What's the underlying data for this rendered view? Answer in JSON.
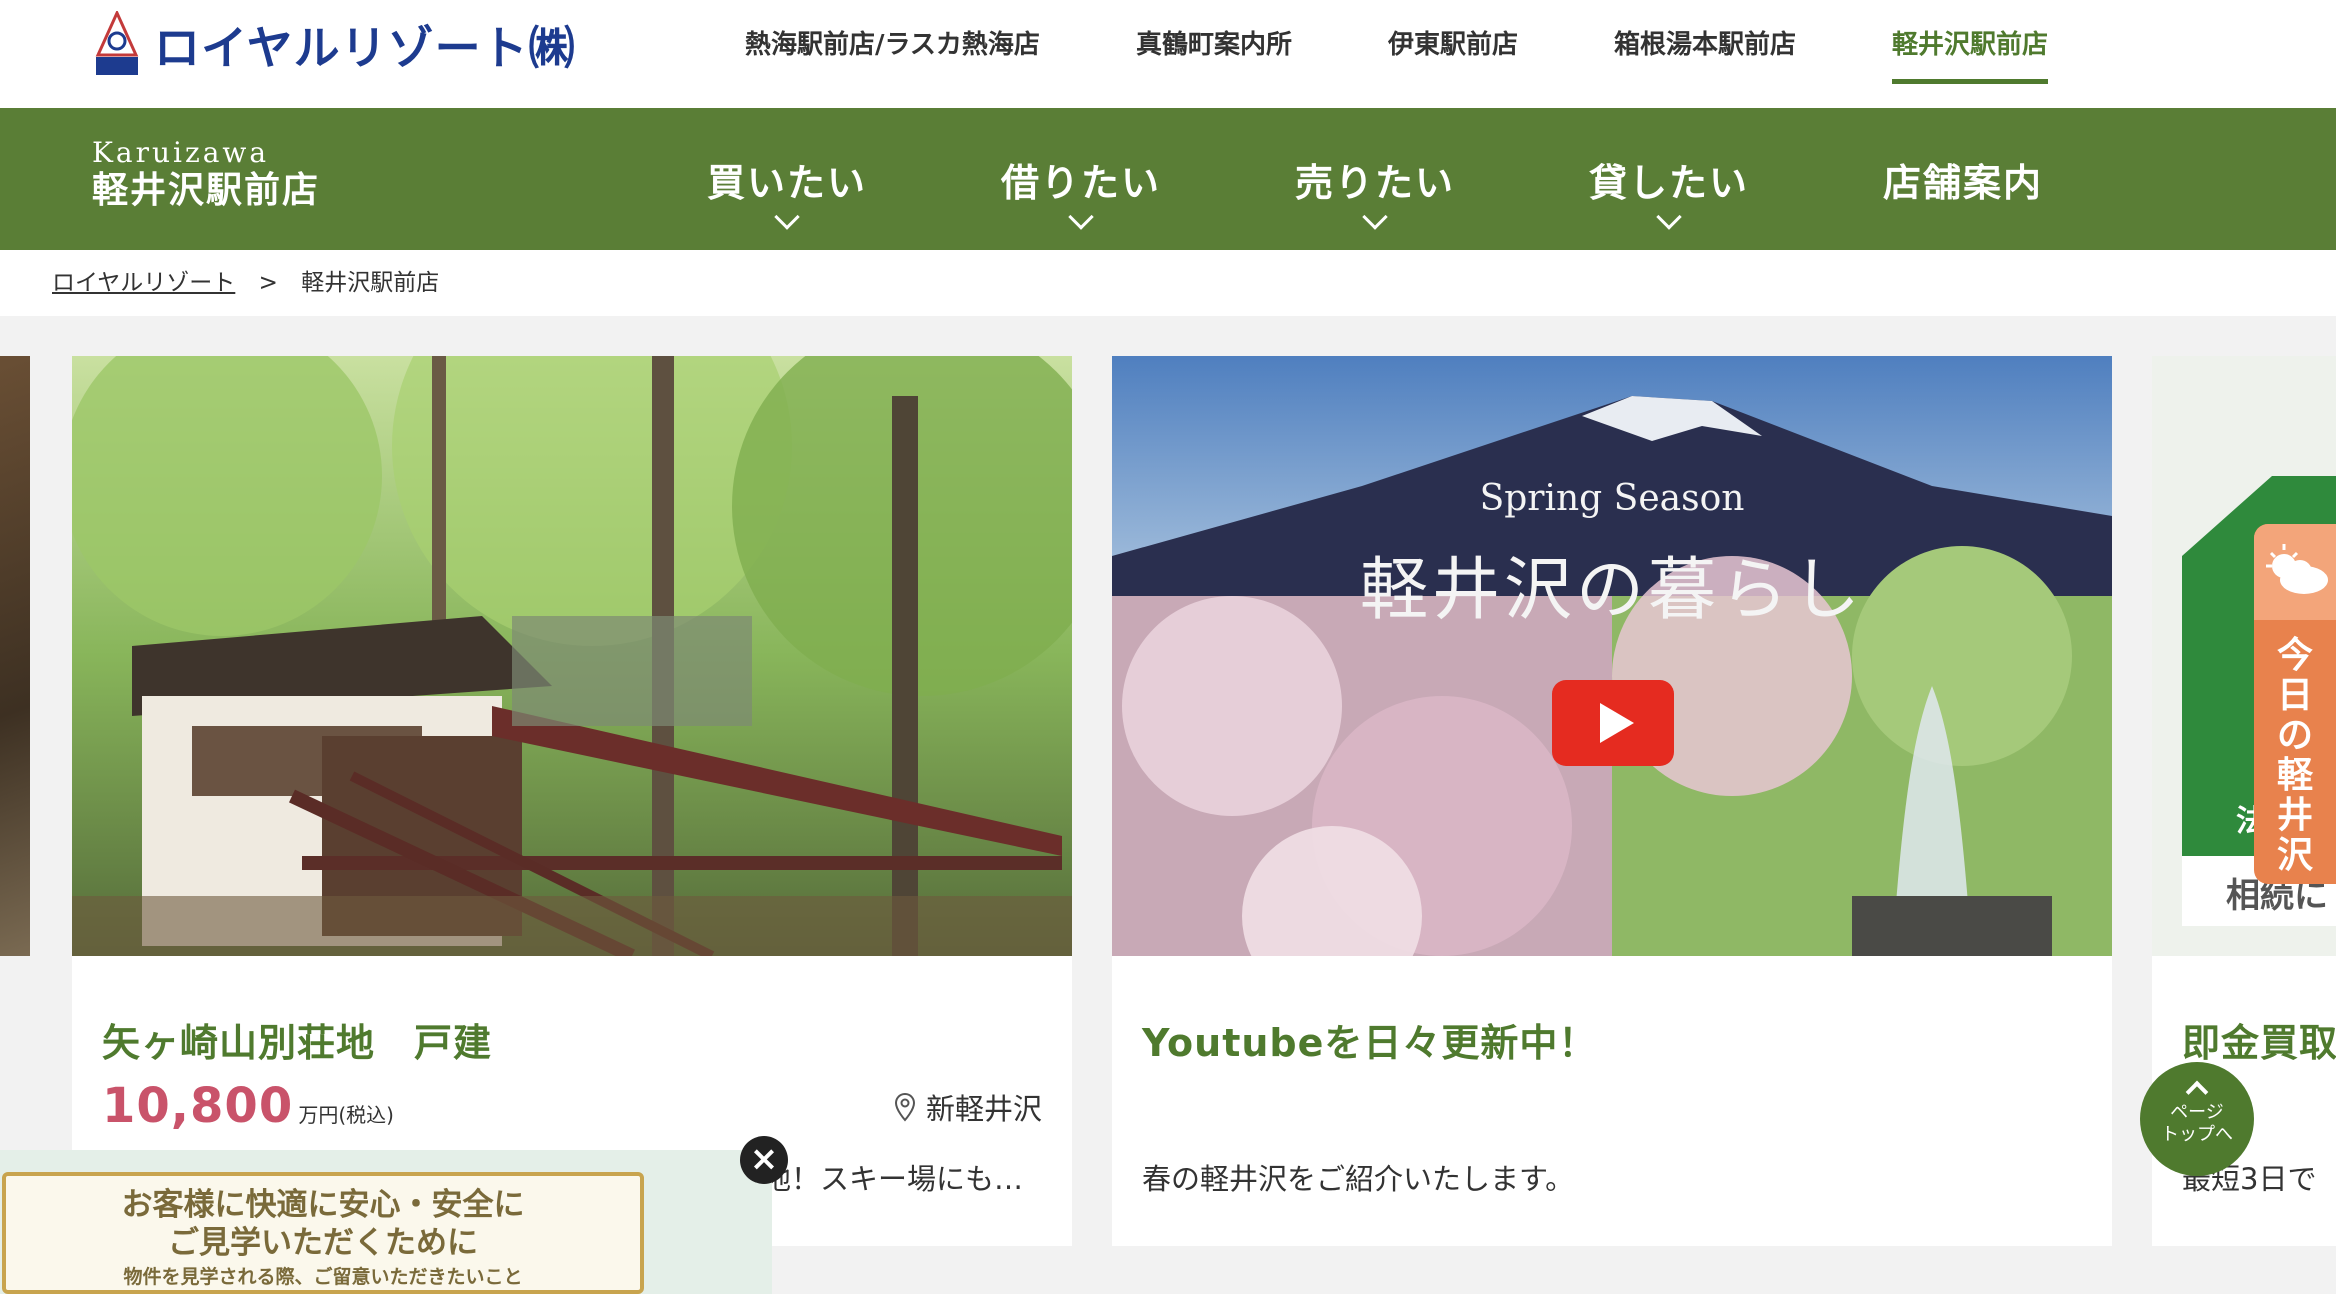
{
  "brand": {
    "name": "ロイヤルリゾート㈱"
  },
  "topnav": [
    {
      "label": "熱海駅前店/ラスカ熱海店"
    },
    {
      "label": "真鶴町案内所"
    },
    {
      "label": "伊東駅前店"
    },
    {
      "label": "箱根湯本駅前店"
    },
    {
      "label": "軽井沢駅前店",
      "active": true
    }
  ],
  "store": {
    "en": "Karuizawa",
    "jp": "軽井沢駅前店"
  },
  "mainnav": [
    {
      "label": "買いたい"
    },
    {
      "label": "借りたい"
    },
    {
      "label": "売りたい"
    },
    {
      "label": "貸したい"
    },
    {
      "label": "店舗案内"
    }
  ],
  "breadcrumb": {
    "home": "ロイヤルリゾート",
    "sep": ">",
    "current": "軽井沢駅前店"
  },
  "cards": [
    {
      "title": "矢ヶ崎山別荘地　戸建",
      "price": "10,800",
      "price_unit": "万円(税込)",
      "location": "新軽井沢",
      "desc": "地！スキー場にも…"
    },
    {
      "title": "Youtubeを日々更新中！",
      "video_sub": "Spring Season",
      "video_title": "軽井沢の暮らし",
      "desc": "春の軽井沢をご紹介いたします。"
    },
    {
      "title": "即金買取",
      "img_text": "相続に",
      "img_text2": "法",
      "desc": "最短3日で"
    }
  ],
  "weather_tab": {
    "label": "今日の軽井沢",
    "icon": "weather-icon"
  },
  "pagetop": {
    "line1": "ページ",
    "line2": "トップへ"
  },
  "banner": {
    "line1": "お客様に快適に安心・安全に",
    "line2": "ご見学いただくために",
    "line3": "物件を見学される際、ご留意いただきたいこと"
  },
  "colors": {
    "green": "#5a7e36",
    "accent_green": "#4f7a2e",
    "price_pink": "#c9536a",
    "orange": "#e8824d"
  }
}
